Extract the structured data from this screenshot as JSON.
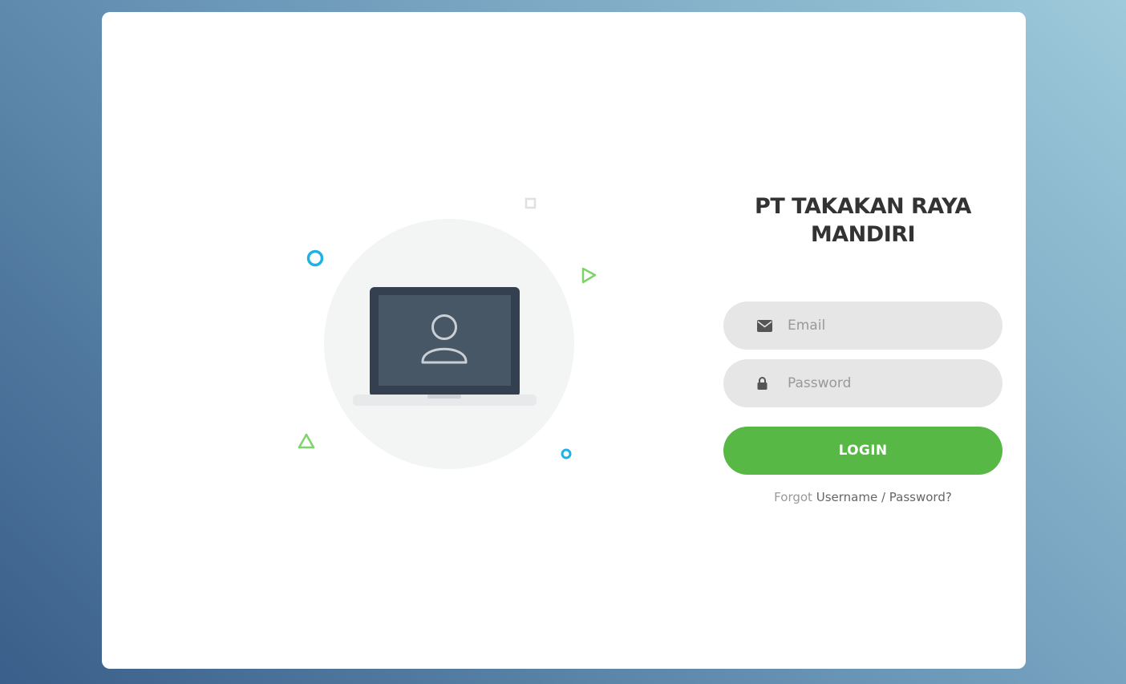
{
  "login": {
    "title": "PT TAKAKAN RAYA MANDIRI",
    "email": {
      "placeholder": "Email",
      "icon": "envelope-icon"
    },
    "password": {
      "placeholder": "Password",
      "icon": "lock-icon"
    },
    "submit_label": "LOGIN",
    "forgot": {
      "prefix": "Forgot",
      "link_label": "Username / Password?"
    }
  },
  "illustration": {
    "icon": "laptop-user-icon"
  },
  "colors": {
    "accent": "#57b846",
    "decor_blue": "#1fb2e6",
    "decor_green": "#7dd46a",
    "input_bg": "#e6e6e6",
    "title": "#333333"
  }
}
